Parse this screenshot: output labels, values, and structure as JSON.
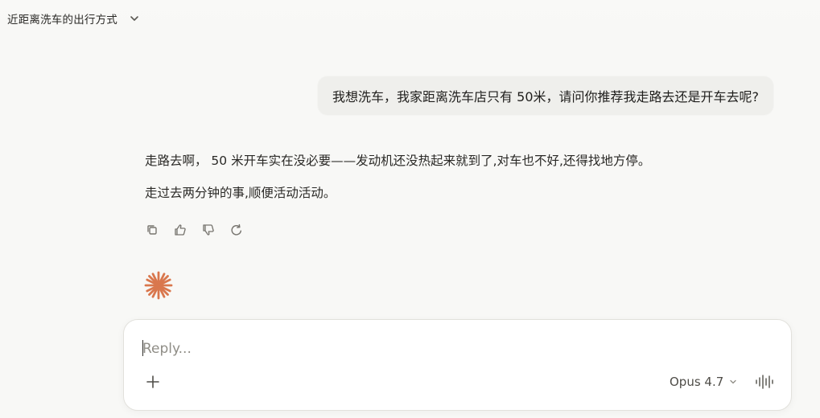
{
  "conversation": {
    "title": "近距离洗车的出行方式"
  },
  "messages": {
    "user": "我想洗车，我家距离洗车店只有 50米，请问你推荐我走路去还是开车去呢?",
    "assistant_line_1": "走路去啊， 50 米开车实在没必要——发动机还没热起来就到了,对车也不好,还得找地方停。",
    "assistant_line_2": "走过去两分钟的事,顺便活动活动。"
  },
  "composer": {
    "placeholder": "Reply...",
    "value": "",
    "model_label": "Opus 4.7"
  },
  "colors": {
    "background": "#f8f8f6",
    "user_bubble": "#efefec",
    "accent_spark": "#d9774d",
    "icon_gray": "#77756f"
  },
  "icons": {
    "title_dropdown": "chevron-down-icon",
    "copy": "copy-icon",
    "like": "thumbs-up-icon",
    "dislike": "thumbs-down-icon",
    "retry": "retry-icon",
    "spark": "spark-icon",
    "add": "plus-icon",
    "voice": "voice-waveform-icon"
  }
}
